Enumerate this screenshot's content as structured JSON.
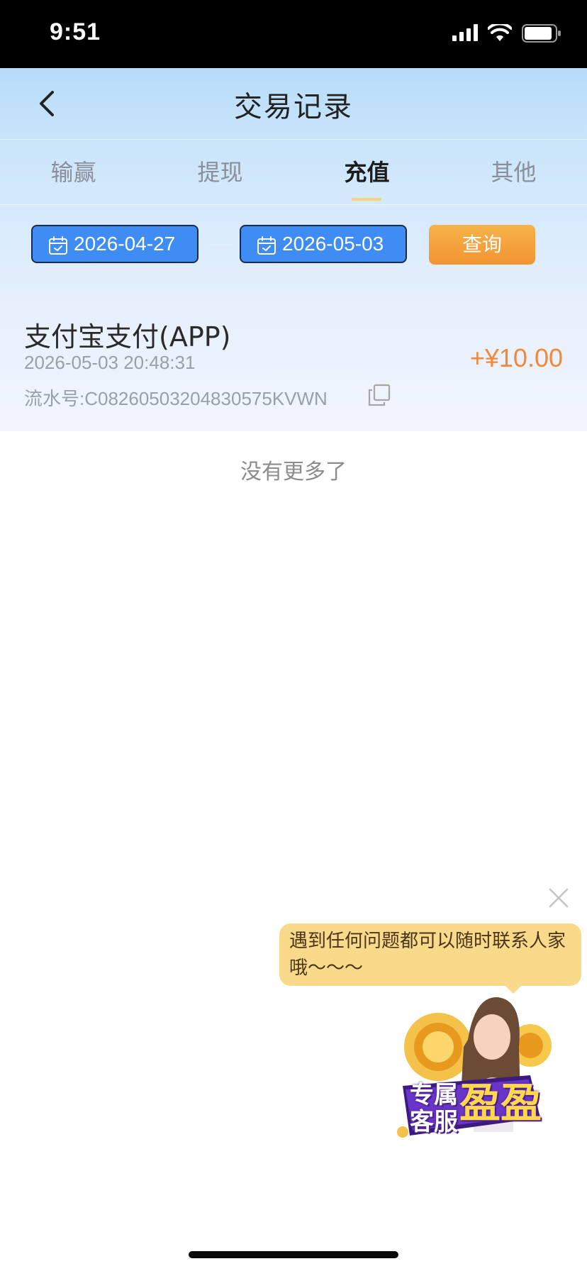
{
  "status_bar": {
    "time": "9:51"
  },
  "header": {
    "title": "交易记录"
  },
  "tabs": [
    {
      "label": "输赢",
      "active": false
    },
    {
      "label": "提现",
      "active": false
    },
    {
      "label": "充值",
      "active": true
    },
    {
      "label": "其他",
      "active": false
    }
  ],
  "filter": {
    "start_date": "2026-04-27",
    "end_date": "2026-05-03",
    "query_label": "查询"
  },
  "records": [
    {
      "method": "支付宝支付(APP)",
      "time": "2026-05-03 20:48:31",
      "serial": "流水号:C08260503204830575KVWN",
      "amount": "+¥10.00"
    }
  ],
  "list_end_text": "没有更多了",
  "service": {
    "bubble_text": "遇到任何问题都可以随时联系人家哦～～～",
    "badge_line1": "专属",
    "badge_line2": "客服",
    "badge_name": "盈盈"
  },
  "colors": {
    "accent_blue": "#3f8df4",
    "query_orange": "#f19432",
    "amount_orange": "#f08a3a",
    "bubble_yellow": "#f9d98a"
  },
  "icons": [
    "back-icon",
    "calendar-icon",
    "copy-icon",
    "close-icon",
    "signal-icon",
    "wifi-icon",
    "battery-icon"
  ]
}
